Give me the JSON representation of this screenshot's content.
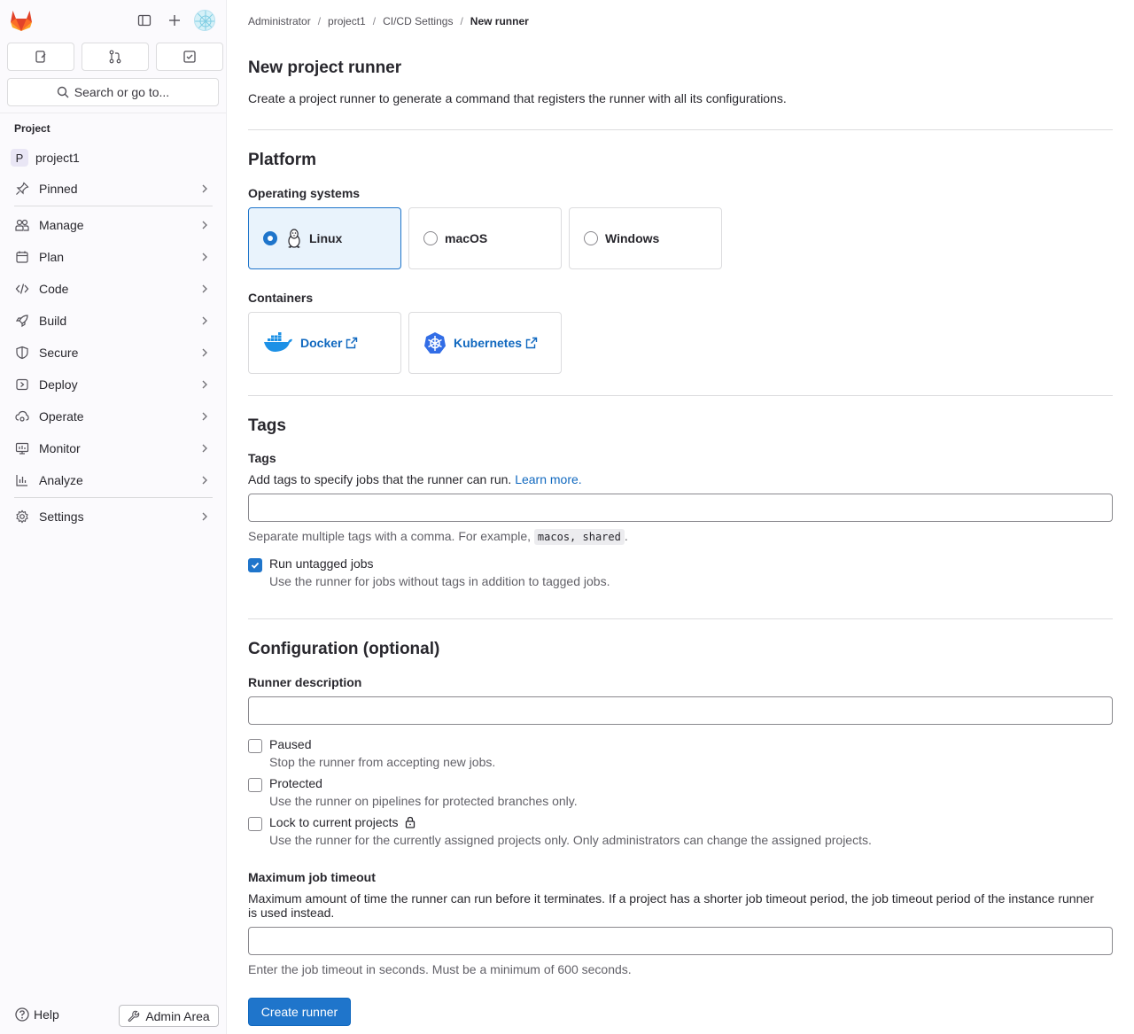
{
  "sidebar": {
    "search_label": "Search or go to...",
    "section_label": "Project",
    "project_badge": "P",
    "project_name": "project1",
    "items": [
      {
        "label": "Pinned",
        "icon": "pin-icon"
      },
      {
        "label": "Manage",
        "icon": "users-icon"
      },
      {
        "label": "Plan",
        "icon": "calendar-icon"
      },
      {
        "label": "Code",
        "icon": "code-icon"
      },
      {
        "label": "Build",
        "icon": "rocket-icon"
      },
      {
        "label": "Secure",
        "icon": "shield-icon"
      },
      {
        "label": "Deploy",
        "icon": "deploy-icon"
      },
      {
        "label": "Operate",
        "icon": "cloud-gear-icon"
      },
      {
        "label": "Monitor",
        "icon": "monitor-icon"
      },
      {
        "label": "Analyze",
        "icon": "chart-icon"
      },
      {
        "label": "Settings",
        "icon": "gear-icon"
      }
    ],
    "help_label": "Help",
    "admin_label": "Admin Area"
  },
  "breadcrumb": [
    "Administrator",
    "project1",
    "CI/CD Settings",
    "New runner"
  ],
  "page": {
    "title": "New project runner",
    "description": "Create a project runner to generate a command that registers the runner with all its configurations."
  },
  "platform": {
    "heading": "Platform",
    "os_label": "Operating systems",
    "os_options": [
      "Linux",
      "macOS",
      "Windows"
    ],
    "selected_os": "Linux",
    "containers_label": "Containers",
    "containers": [
      "Docker",
      "Kubernetes"
    ]
  },
  "tags": {
    "heading": "Tags",
    "label": "Tags",
    "description": "Add tags to specify jobs that the runner can run.",
    "learn_more": "Learn more.",
    "input_value": "",
    "help_prefix": "Separate multiple tags with a comma. For example,",
    "help_code": "macos, shared",
    "help_suffix": ".",
    "untagged_label": "Run untagged jobs",
    "untagged_checked": true,
    "untagged_help": "Use the runner for jobs without tags in addition to tagged jobs."
  },
  "config": {
    "heading": "Configuration (optional)",
    "description_label": "Runner description",
    "description_value": "",
    "paused_label": "Paused",
    "paused_help": "Stop the runner from accepting new jobs.",
    "protected_label": "Protected",
    "protected_help": "Use the runner on pipelines for protected branches only.",
    "lock_label": "Lock to current projects",
    "lock_help": "Use the runner for the currently assigned projects only. Only administrators can change the assigned projects.",
    "timeout_label": "Maximum job timeout",
    "timeout_description": "Maximum amount of time the runner can run before it terminates. If a project has a shorter job timeout period, the job timeout period of the instance runner is used instead.",
    "timeout_value": "",
    "timeout_help": "Enter the job timeout in seconds. Must be a minimum of 600 seconds.",
    "submit_label": "Create runner"
  },
  "colors": {
    "accent": "#1f75cb",
    "link": "#1068bf",
    "selected_bg": "#e9f3fc"
  }
}
